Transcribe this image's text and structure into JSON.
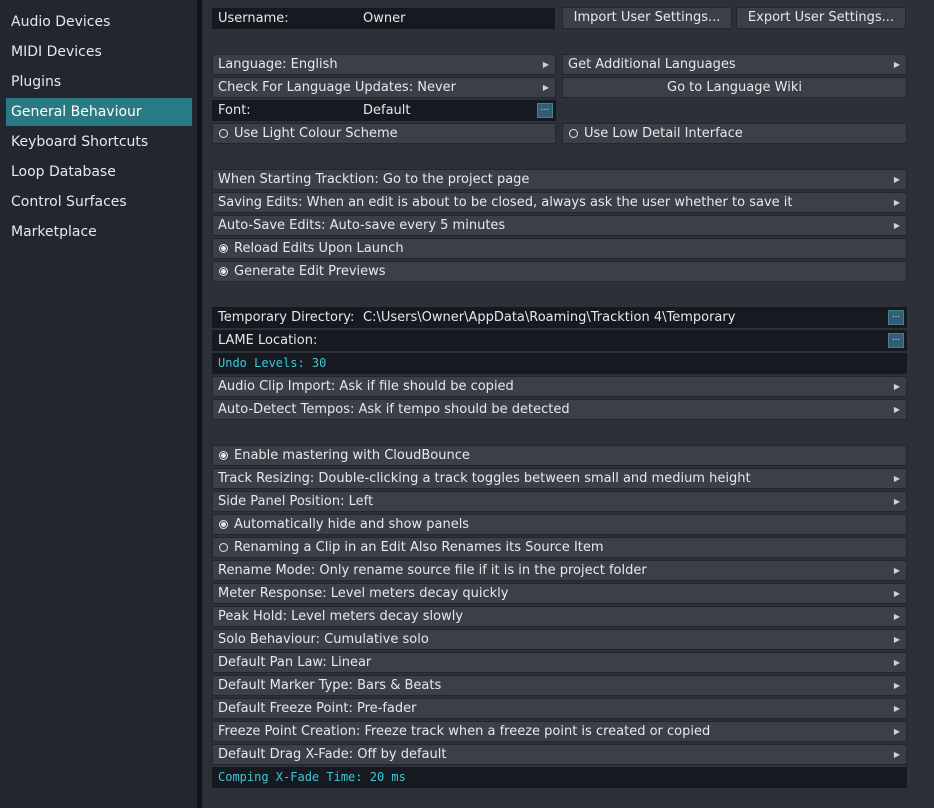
{
  "colors": {
    "accent": "#2a7a84",
    "mono_text": "#3fc8d4"
  },
  "sidebar": {
    "items": [
      {
        "label": "Audio Devices"
      },
      {
        "label": "MIDI Devices"
      },
      {
        "label": "Plugins"
      },
      {
        "label": "General Behaviour",
        "selected": true
      },
      {
        "label": "Keyboard Shortcuts"
      },
      {
        "label": "Loop Database"
      },
      {
        "label": "Control Surfaces"
      },
      {
        "label": "Marketplace"
      }
    ]
  },
  "user": {
    "username_label": "Username:",
    "username_value": "Owner",
    "import_label": "Import User Settings...",
    "export_label": "Export User Settings..."
  },
  "language": {
    "language_label": "Language: English",
    "get_languages_label": "Get Additional Languages",
    "updates_label": "Check For Language Updates: Never",
    "wiki_label": "Go to Language Wiki",
    "font_label": "Font:",
    "font_value": "Default",
    "browse_label": "...",
    "light_scheme_label": "Use Light Colour Scheme",
    "light_scheme_checked": false,
    "low_detail_label": "Use Low Detail Interface",
    "low_detail_checked": false
  },
  "startup": {
    "starting_label": "When Starting Tracktion: Go to the project page",
    "saving_label": "Saving Edits: When an edit is about to be closed, always ask the user whether to save it",
    "autosave_label": "Auto-Save Edits: Auto-save every 5 minutes",
    "reload_label": "Reload Edits Upon Launch",
    "reload_checked": true,
    "previews_label": "Generate Edit Previews",
    "previews_checked": true
  },
  "files": {
    "temp_dir_label": "Temporary Directory:",
    "temp_dir_value": "C:\\Users\\Owner\\AppData\\Roaming\\Tracktion 4\\Temporary",
    "lame_label": "LAME Location:",
    "browse_label": "...",
    "undo_label": "Undo Levels: 30",
    "audio_import_label": "Audio Clip Import: Ask if file should be copied",
    "tempo_label": "Auto-Detect Tempos: Ask if tempo should be detected"
  },
  "editing": {
    "mastering_label": "Enable mastering with CloudBounce",
    "mastering_checked": true,
    "track_resizing_label": "Track Resizing: Double-clicking a track toggles between small and medium height",
    "side_panel_label": "Side Panel Position: Left",
    "auto_hide_label": "Automatically hide and show panels",
    "auto_hide_checked": true,
    "renaming_label": "Renaming a Clip in an Edit Also Renames its Source Item",
    "renaming_checked": false,
    "rename_mode_label": "Rename Mode: Only rename source file if it is in the project folder",
    "meter_label": "Meter Response: Level meters decay quickly",
    "peak_label": "Peak Hold: Level meters decay slowly",
    "solo_label": "Solo Behaviour: Cumulative solo",
    "pan_label": "Default Pan Law: Linear",
    "marker_label": "Default Marker Type: Bars & Beats",
    "freeze_point_label": "Default Freeze Point: Pre-fader",
    "freeze_creation_label": "Freeze Point Creation: Freeze track when a freeze point is created or copied",
    "drag_xfade_label": "Default Drag X-Fade: Off by default",
    "comping_label": "Comping X-Fade Time: 20 ms"
  }
}
